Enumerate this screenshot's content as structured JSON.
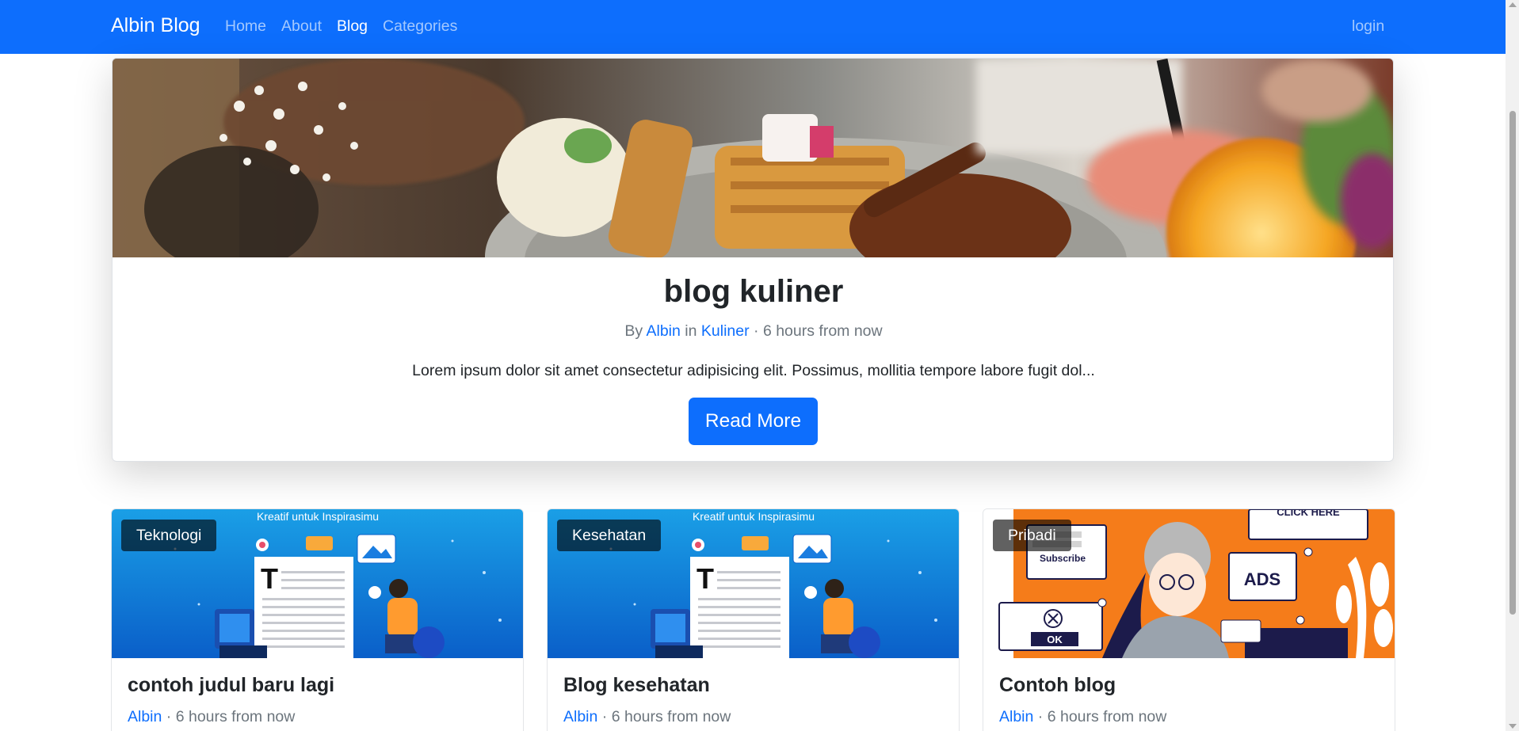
{
  "navbar": {
    "brand": "Albin Blog",
    "links": [
      {
        "label": "Home",
        "active": false
      },
      {
        "label": "About",
        "active": false
      },
      {
        "label": "Blog",
        "active": true
      },
      {
        "label": "Categories",
        "active": false
      }
    ],
    "login": "login",
    "background": "#0d6efd"
  },
  "hero": {
    "image_icon": "food-waffles-photo",
    "title": "blog kuliner",
    "meta": {
      "by": "By",
      "author": "Albin",
      "in": "in",
      "category": "Kuliner",
      "time": "· 6 hours from now"
    },
    "excerpt": "Lorem ipsum dolor sit amet consectetur adipisicing elit. Possimus, mollitia tempore labore fugit dol...",
    "button": "Read More"
  },
  "posts": [
    {
      "category": "Teknologi",
      "image_caption": "Kreatif untuk Inspirasimu",
      "image_icon": "content-creator-illustration",
      "title": "contoh judul baru lagi",
      "author": "Albin",
      "time": "· 6 hours from now"
    },
    {
      "category": "Kesehatan",
      "image_caption": "Kreatif untuk Inspirasimu",
      "image_icon": "content-creator-illustration",
      "title": "Blog kesehatan",
      "author": "Albin",
      "time": "· 6 hours from now"
    },
    {
      "category": "Pribadi",
      "image_icon": "ads-illustration",
      "image_texts": {
        "click": "CLICK HERE",
        "subscribe": "Subscribe",
        "ads": "ADS",
        "ok": "OK"
      },
      "title": "Contoh blog",
      "author": "Albin",
      "time": "· 6 hours from now"
    }
  ],
  "colors": {
    "primary": "#0d6efd",
    "muted": "#6c757d",
    "text": "#212529"
  }
}
